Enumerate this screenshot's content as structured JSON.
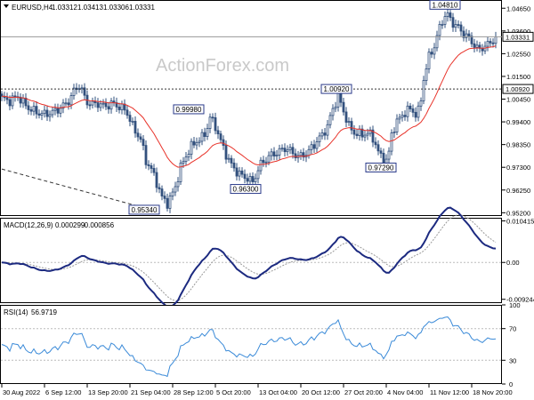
{
  "chart_data": [
    {
      "panel": "price",
      "type": "candlestick",
      "info": {
        "symbol": "EURUSD,H4",
        "ohlc": [
          "1.03312",
          "1.03413",
          "1.03306",
          "1.03331"
        ]
      },
      "watermark": "ActionForex.com",
      "ylim": [
        0.9505,
        1.0503
      ],
      "y_ticks": [
        "1.04650",
        "1.03600",
        "1.02550",
        "1.01500",
        "1.00450",
        "0.99400",
        "0.98350",
        "0.97300",
        "0.96250",
        "0.95200"
      ],
      "horizontal_lines": [
        {
          "value": 1.03331,
          "label": "1.03331",
          "style": "solid"
        },
        {
          "value": 1.0092,
          "label": "1.00920",
          "style": "dotted"
        }
      ],
      "trendline": {
        "style": "dashed",
        "color": "#333333",
        "from": {
          "t": 0,
          "y": 0.9722
        },
        "to": {
          "t": 151,
          "y": 0.9553
        }
      },
      "annotations": [
        {
          "label": "0.95340",
          "t": 160,
          "value": 0.9534
        },
        {
          "label": "0.99980",
          "t": 210,
          "value": 0.9998
        },
        {
          "label": "0.96300",
          "t": 274,
          "value": 0.963
        },
        {
          "label": "1.00920",
          "t": 376,
          "value": 1.0092
        },
        {
          "label": "0.97290",
          "t": 426,
          "value": 0.9729
        },
        {
          "label": "1.04810",
          "t": 498,
          "value": 1.0481
        }
      ],
      "ma_color": "#e8332a",
      "candle_color": "#32507d",
      "close_keypoints": [
        [
          0,
          1.005
        ],
        [
          8,
          1.0035
        ],
        [
          18,
          1.0058
        ],
        [
          28,
          1.001
        ],
        [
          38,
          0.9985
        ],
        [
          48,
          0.9975
        ],
        [
          58,
          0.9985
        ],
        [
          68,
          1.001
        ],
        [
          76,
          1.004
        ],
        [
          82,
          1.009
        ],
        [
          88,
          1.011
        ],
        [
          94,
          1.004
        ],
        [
          100,
          1.002
        ],
        [
          108,
          1.0025
        ],
        [
          116,
          1.001
        ],
        [
          124,
          1.0025
        ],
        [
          132,
          1.001
        ],
        [
          140,
          0.999
        ],
        [
          148,
          0.991
        ],
        [
          156,
          0.986
        ],
        [
          162,
          0.976
        ],
        [
          168,
          0.972
        ],
        [
          174,
          0.966
        ],
        [
          180,
          0.959
        ],
        [
          186,
          0.9565
        ],
        [
          190,
          0.959
        ],
        [
          196,
          0.965
        ],
        [
          200,
          0.972
        ],
        [
          206,
          0.9775
        ],
        [
          212,
          0.982
        ],
        [
          218,
          0.985
        ],
        [
          224,
          0.986
        ],
        [
          230,
          0.99
        ],
        [
          234,
          0.996
        ],
        [
          240,
          0.992
        ],
        [
          246,
          0.985
        ],
        [
          252,
          0.979
        ],
        [
          258,
          0.974
        ],
        [
          264,
          0.971
        ],
        [
          270,
          0.969
        ],
        [
          276,
          0.968
        ],
        [
          282,
          0.966
        ],
        [
          290,
          0.974
        ],
        [
          300,
          0.978
        ],
        [
          310,
          0.98
        ],
        [
          320,
          0.982
        ],
        [
          328,
          0.979
        ],
        [
          336,
          0.978
        ],
        [
          344,
          0.98
        ],
        [
          352,
          0.984
        ],
        [
          360,
          0.988
        ],
        [
          366,
          0.992
        ],
        [
          372,
          1.0
        ],
        [
          378,
          1.006
        ],
        [
          384,
          0.999
        ],
        [
          390,
          0.992
        ],
        [
          396,
          0.989
        ],
        [
          404,
          0.988
        ],
        [
          412,
          0.989
        ],
        [
          418,
          0.986
        ],
        [
          424,
          0.979
        ],
        [
          430,
          0.9755
        ],
        [
          434,
          0.977
        ],
        [
          438,
          0.988
        ],
        [
          442,
          0.993
        ],
        [
          448,
          0.996
        ],
        [
          454,
          0.999
        ],
        [
          460,
          1.0
        ],
        [
          466,
          0.997
        ],
        [
          470,
          1.001
        ],
        [
          474,
          1.014
        ],
        [
          480,
          1.024
        ],
        [
          486,
          1.029
        ],
        [
          490,
          1.035
        ],
        [
          496,
          1.042
        ],
        [
          500,
          1.044
        ],
        [
          506,
          1.04
        ],
        [
          512,
          1.038
        ],
        [
          518,
          1.035
        ],
        [
          524,
          1.033
        ],
        [
          530,
          1.03
        ],
        [
          536,
          1.027
        ],
        [
          542,
          1.029
        ],
        [
          548,
          1.03
        ],
        [
          552,
          1.032
        ],
        [
          555,
          1.0333
        ]
      ]
    },
    {
      "panel": "macd",
      "type": "line",
      "info": {
        "label": "MACD(12,26,9)",
        "values": [
          "0.000299",
          "-0.000856"
        ]
      },
      "ylim": [
        -0.0102,
        0.0112
      ],
      "y_ticks": [
        "0.010415",
        "0.00",
        "-0.009244"
      ],
      "series": [
        {
          "color": "#1c2a80"
        },
        {
          "color": "#999999",
          "style": "dotted"
        }
      ]
    },
    {
      "panel": "rsi",
      "type": "line",
      "info": {
        "label": "RSI(14)",
        "value": "56.9719"
      },
      "ylim": [
        0,
        100
      ],
      "y_ticks": [
        "100",
        "70",
        "30",
        "0"
      ],
      "levels": [
        70,
        30
      ],
      "series": [
        {
          "color": "#3a8ad8"
        }
      ]
    }
  ],
  "x_axis": {
    "labels": [
      "30 Aug 2022",
      "6 Sep 12:00",
      "13 Sep 20:00",
      "21 Sep 04:00",
      "28 Sep 12:00",
      "5 Oct 20:00",
      "13 Oct 04:00",
      "20 Oct 12:00",
      "27 Oct 20:00",
      "4 Nov 04:00",
      "11 Nov 12:00",
      "18 Nov 20:00"
    ]
  }
}
